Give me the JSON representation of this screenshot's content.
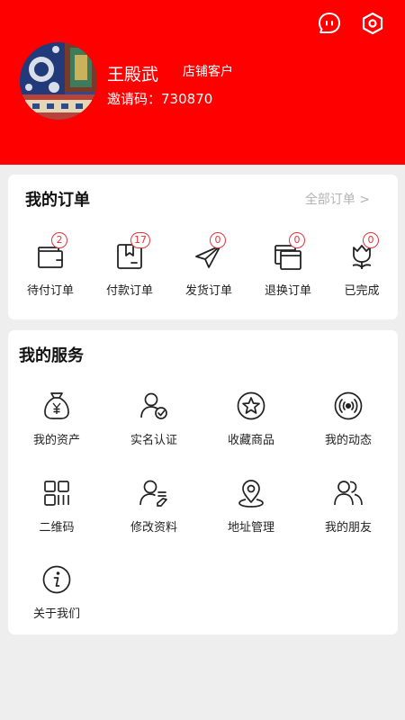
{
  "header": {
    "user_name": "王殿武",
    "user_role": "店铺客户",
    "invite_label": "邀请码：",
    "invite_code": "730870"
  },
  "icons": {
    "message": "chat-bubble-icon",
    "settings": "hexagon-gear-icon"
  },
  "orders": {
    "title": "我的订单",
    "all_link": "全部订单 >",
    "items": [
      {
        "label": "待付订单",
        "badge": "2",
        "icon": "wallet-icon"
      },
      {
        "label": "付款订单",
        "badge": "17",
        "icon": "box-icon"
      },
      {
        "label": "发货订单",
        "badge": "0",
        "icon": "paper-plane-icon"
      },
      {
        "label": "退换订单",
        "badge": "0",
        "icon": "windows-icon"
      },
      {
        "label": "已完成",
        "badge": "0",
        "icon": "tulip-icon"
      }
    ]
  },
  "services": {
    "title": "我的服务",
    "items": [
      {
        "label": "我的资产",
        "icon": "money-bag-icon"
      },
      {
        "label": "实名认证",
        "icon": "verified-user-icon"
      },
      {
        "label": "收藏商品",
        "icon": "star-circle-icon"
      },
      {
        "label": "我的动态",
        "icon": "broadcast-icon"
      },
      {
        "label": "二维码",
        "icon": "qr-code-icon"
      },
      {
        "label": "修改资料",
        "icon": "edit-profile-icon"
      },
      {
        "label": "地址管理",
        "icon": "location-pin-icon"
      },
      {
        "label": "我的朋友",
        "icon": "friends-icon"
      },
      {
        "label": "关于我们",
        "icon": "info-icon"
      }
    ]
  },
  "colors": {
    "header_red": "#fe0000",
    "badge_red": "#e3333a",
    "page_bg": "#eeeeee"
  }
}
